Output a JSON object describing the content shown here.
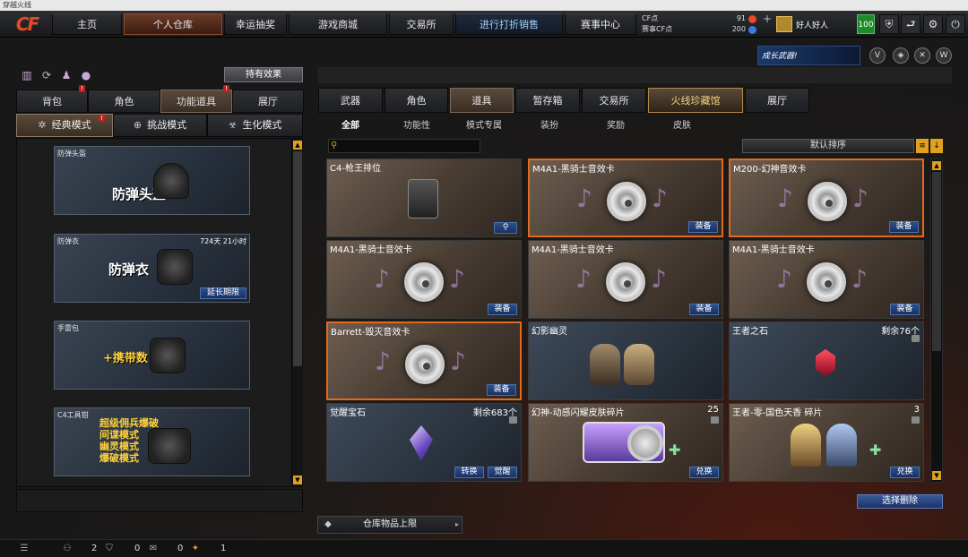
{
  "window": {
    "title": "穿越火线"
  },
  "logo": "CF",
  "nav": {
    "tabs": [
      "主页",
      "个人仓库",
      "幸运抽奖",
      "游戏商城",
      "交易所",
      "进行打折销售",
      "赛事中心"
    ]
  },
  "currency": {
    "cf_label": "CF点",
    "cf_value": "91",
    "match_label": "赛事CF点",
    "match_value": "200",
    "plus": "+"
  },
  "user": {
    "name": "好人好人",
    "level": "100"
  },
  "banner": {
    "text": "成长武器!"
  },
  "left": {
    "effect_button": "持有效果",
    "subtabs": [
      "背包",
      "角色",
      "功能道具",
      "展厅"
    ],
    "modes": [
      "经典模式",
      "挑战模式",
      "生化模式"
    ],
    "cards": [
      {
        "name": "防弹头盔",
        "big": "防弹头盔"
      },
      {
        "name": "防弹衣",
        "big": "防弹衣",
        "time": "724天 21小时",
        "button": "延长期限"
      },
      {
        "name": "手雷包",
        "big": "+携带数"
      },
      {
        "name": "C4工具钳",
        "lines": [
          "超级佣兵爆破",
          "间谍模式",
          "幽灵模式",
          "爆破模式"
        ]
      }
    ]
  },
  "right": {
    "main_tabs": [
      "武器",
      "角色",
      "道具",
      "暂存箱",
      "交易所",
      "火线珍藏馆",
      "展厅"
    ],
    "category_tabs": [
      "全部",
      "功能性",
      "模式专属",
      "装扮",
      "奖励",
      "皮肤"
    ],
    "sort_label": "默认排序",
    "items": [
      {
        "name": "C4-枪王排位",
        "button": "",
        "count": ""
      },
      {
        "name": "M4A1-黑骑士音效卡",
        "button": "装备",
        "count": ""
      },
      {
        "name": "M200-幻神音效卡",
        "button": "装备",
        "count": ""
      },
      {
        "name": "M4A1-黑骑士音效卡",
        "button": "装备",
        "count": ""
      },
      {
        "name": "M4A1-黑骑士音效卡",
        "button": "装备",
        "count": ""
      },
      {
        "name": "M4A1-黑骑士音效卡",
        "button": "装备",
        "count": ""
      },
      {
        "name": "Barrett-毁灭音效卡",
        "button": "装备",
        "count": ""
      },
      {
        "name": "幻影幽灵",
        "button": "",
        "count": ""
      },
      {
        "name": "王者之石",
        "button": "",
        "count": "剩余76个"
      },
      {
        "name": "觉醒宝石",
        "button": "觉醒",
        "button2": "转换",
        "count": "剩余683个"
      },
      {
        "name": "幻神-动感闪耀皮肤碎片",
        "button": "兑换",
        "count": "25"
      },
      {
        "name": "王者-零-国色天香 碎片",
        "button": "兑换",
        "count": "3"
      }
    ],
    "select_delete": "选择删除",
    "storage_limit": "仓库物品上限"
  },
  "bottom": {
    "friends_count": "2",
    "shield_count": "0",
    "chat_count": "0",
    "gift_count": "1"
  }
}
